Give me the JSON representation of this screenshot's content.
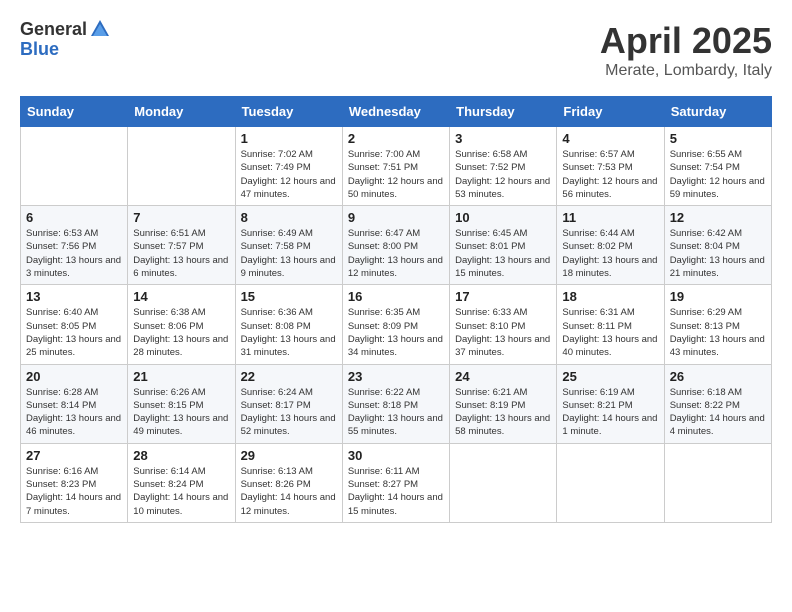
{
  "header": {
    "logo_general": "General",
    "logo_blue": "Blue",
    "title": "April 2025",
    "location": "Merate, Lombardy, Italy"
  },
  "days_of_week": [
    "Sunday",
    "Monday",
    "Tuesday",
    "Wednesday",
    "Thursday",
    "Friday",
    "Saturday"
  ],
  "weeks": [
    [
      {
        "day": "",
        "info": ""
      },
      {
        "day": "",
        "info": ""
      },
      {
        "day": "1",
        "info": "Sunrise: 7:02 AM\nSunset: 7:49 PM\nDaylight: 12 hours and 47 minutes."
      },
      {
        "day": "2",
        "info": "Sunrise: 7:00 AM\nSunset: 7:51 PM\nDaylight: 12 hours and 50 minutes."
      },
      {
        "day": "3",
        "info": "Sunrise: 6:58 AM\nSunset: 7:52 PM\nDaylight: 12 hours and 53 minutes."
      },
      {
        "day": "4",
        "info": "Sunrise: 6:57 AM\nSunset: 7:53 PM\nDaylight: 12 hours and 56 minutes."
      },
      {
        "day": "5",
        "info": "Sunrise: 6:55 AM\nSunset: 7:54 PM\nDaylight: 12 hours and 59 minutes."
      }
    ],
    [
      {
        "day": "6",
        "info": "Sunrise: 6:53 AM\nSunset: 7:56 PM\nDaylight: 13 hours and 3 minutes."
      },
      {
        "day": "7",
        "info": "Sunrise: 6:51 AM\nSunset: 7:57 PM\nDaylight: 13 hours and 6 minutes."
      },
      {
        "day": "8",
        "info": "Sunrise: 6:49 AM\nSunset: 7:58 PM\nDaylight: 13 hours and 9 minutes."
      },
      {
        "day": "9",
        "info": "Sunrise: 6:47 AM\nSunset: 8:00 PM\nDaylight: 13 hours and 12 minutes."
      },
      {
        "day": "10",
        "info": "Sunrise: 6:45 AM\nSunset: 8:01 PM\nDaylight: 13 hours and 15 minutes."
      },
      {
        "day": "11",
        "info": "Sunrise: 6:44 AM\nSunset: 8:02 PM\nDaylight: 13 hours and 18 minutes."
      },
      {
        "day": "12",
        "info": "Sunrise: 6:42 AM\nSunset: 8:04 PM\nDaylight: 13 hours and 21 minutes."
      }
    ],
    [
      {
        "day": "13",
        "info": "Sunrise: 6:40 AM\nSunset: 8:05 PM\nDaylight: 13 hours and 25 minutes."
      },
      {
        "day": "14",
        "info": "Sunrise: 6:38 AM\nSunset: 8:06 PM\nDaylight: 13 hours and 28 minutes."
      },
      {
        "day": "15",
        "info": "Sunrise: 6:36 AM\nSunset: 8:08 PM\nDaylight: 13 hours and 31 minutes."
      },
      {
        "day": "16",
        "info": "Sunrise: 6:35 AM\nSunset: 8:09 PM\nDaylight: 13 hours and 34 minutes."
      },
      {
        "day": "17",
        "info": "Sunrise: 6:33 AM\nSunset: 8:10 PM\nDaylight: 13 hours and 37 minutes."
      },
      {
        "day": "18",
        "info": "Sunrise: 6:31 AM\nSunset: 8:11 PM\nDaylight: 13 hours and 40 minutes."
      },
      {
        "day": "19",
        "info": "Sunrise: 6:29 AM\nSunset: 8:13 PM\nDaylight: 13 hours and 43 minutes."
      }
    ],
    [
      {
        "day": "20",
        "info": "Sunrise: 6:28 AM\nSunset: 8:14 PM\nDaylight: 13 hours and 46 minutes."
      },
      {
        "day": "21",
        "info": "Sunrise: 6:26 AM\nSunset: 8:15 PM\nDaylight: 13 hours and 49 minutes."
      },
      {
        "day": "22",
        "info": "Sunrise: 6:24 AM\nSunset: 8:17 PM\nDaylight: 13 hours and 52 minutes."
      },
      {
        "day": "23",
        "info": "Sunrise: 6:22 AM\nSunset: 8:18 PM\nDaylight: 13 hours and 55 minutes."
      },
      {
        "day": "24",
        "info": "Sunrise: 6:21 AM\nSunset: 8:19 PM\nDaylight: 13 hours and 58 minutes."
      },
      {
        "day": "25",
        "info": "Sunrise: 6:19 AM\nSunset: 8:21 PM\nDaylight: 14 hours and 1 minute."
      },
      {
        "day": "26",
        "info": "Sunrise: 6:18 AM\nSunset: 8:22 PM\nDaylight: 14 hours and 4 minutes."
      }
    ],
    [
      {
        "day": "27",
        "info": "Sunrise: 6:16 AM\nSunset: 8:23 PM\nDaylight: 14 hours and 7 minutes."
      },
      {
        "day": "28",
        "info": "Sunrise: 6:14 AM\nSunset: 8:24 PM\nDaylight: 14 hours and 10 minutes."
      },
      {
        "day": "29",
        "info": "Sunrise: 6:13 AM\nSunset: 8:26 PM\nDaylight: 14 hours and 12 minutes."
      },
      {
        "day": "30",
        "info": "Sunrise: 6:11 AM\nSunset: 8:27 PM\nDaylight: 14 hours and 15 minutes."
      },
      {
        "day": "",
        "info": ""
      },
      {
        "day": "",
        "info": ""
      },
      {
        "day": "",
        "info": ""
      }
    ]
  ]
}
